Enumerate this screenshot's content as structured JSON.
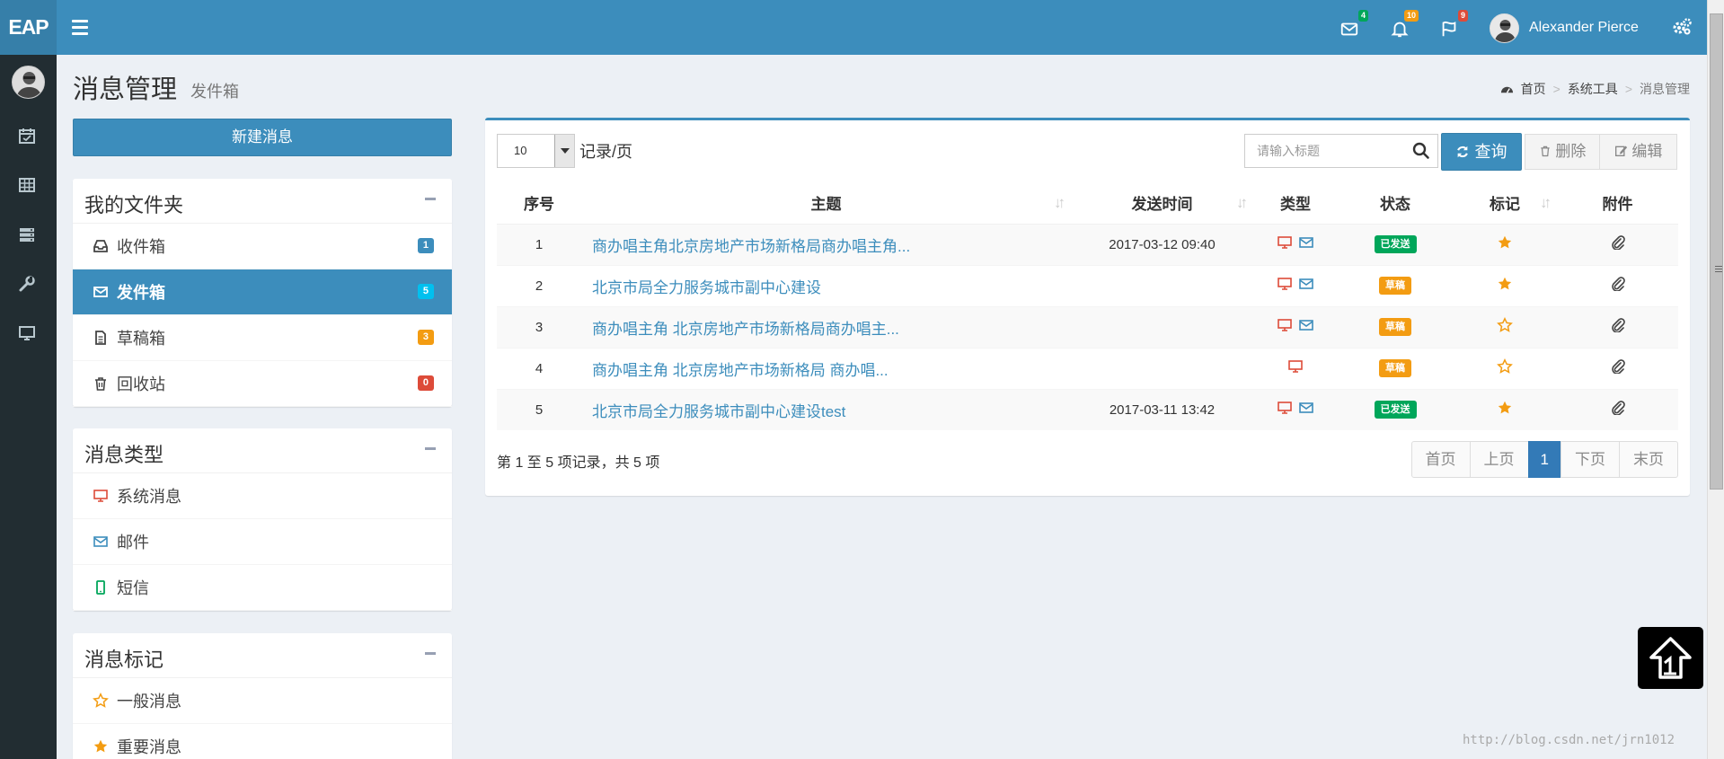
{
  "app": {
    "logo": "EAP",
    "user_name": "Alexander Pierce",
    "notifications": {
      "mail_count": "4",
      "bell_count": "10",
      "flag_count": "9"
    }
  },
  "page": {
    "title": "消息管理",
    "subtitle": "发件箱",
    "breadcrumb": [
      "首页",
      "系统工具",
      "消息管理"
    ]
  },
  "compose_label": "新建消息",
  "folders": {
    "title": "我的文件夹",
    "items": [
      {
        "label": "收件箱",
        "count": "1",
        "color": "#3c8dbc",
        "icon": "inbox-icon"
      },
      {
        "label": "发件箱",
        "count": "5",
        "color": "#00c0ef",
        "icon": "envelope-icon"
      },
      {
        "label": "草稿箱",
        "count": "3",
        "color": "#f39c12",
        "icon": "file-icon"
      },
      {
        "label": "回收站",
        "count": "0",
        "color": "#dd4b39",
        "icon": "trash-icon"
      }
    ]
  },
  "message_types": {
    "title": "消息类型",
    "items": [
      {
        "label": "系统消息",
        "icon": "monitor-icon"
      },
      {
        "label": "邮件",
        "icon": "envelope-icon"
      },
      {
        "label": "短信",
        "icon": "mobile-icon"
      }
    ]
  },
  "message_marks": {
    "title": "消息标记",
    "items": [
      {
        "label": "一般消息",
        "icon": "star-outline-icon"
      },
      {
        "label": "重要消息",
        "icon": "star-filled-icon"
      }
    ]
  },
  "toolbar": {
    "page_size": "10",
    "page_size_label": "记录/页",
    "search_placeholder": "请输入标题",
    "query_label": "查询",
    "delete_label": "删除",
    "edit_label": "编辑"
  },
  "table": {
    "headers": [
      "序号",
      "主题",
      "发送时间",
      "类型",
      "状态",
      "标记",
      "附件"
    ],
    "rows": [
      {
        "no": "1",
        "subject": "商办唱主角北京房地产市场新格局商办唱主角...",
        "time": "2017-03-12 09:40",
        "system": true,
        "mail": true,
        "status": "已发送",
        "starred": true
      },
      {
        "no": "2",
        "subject": "北京市局全力服务城市副中心建设",
        "time": "",
        "system": true,
        "mail": true,
        "status": "草稿",
        "starred": true
      },
      {
        "no": "3",
        "subject": "商办唱主角 北京房地产市场新格局商办唱主...",
        "time": "",
        "system": true,
        "mail": true,
        "status": "草稿",
        "starred": false
      },
      {
        "no": "4",
        "subject": "商办唱主角 北京房地产市场新格局 商办唱...",
        "time": "",
        "system": true,
        "mail": false,
        "status": "草稿",
        "starred": false
      },
      {
        "no": "5",
        "subject": "北京市局全力服务城市副中心建设test",
        "time": "2017-03-11 13:42",
        "system": true,
        "mail": true,
        "status": "已发送",
        "starred": true
      }
    ]
  },
  "status_colors": {
    "已发送": "#00a65a",
    "草稿": "#f39c12"
  },
  "summary": "第 1 至 5 项记录，共 5 项",
  "pager": [
    "首页",
    "上页",
    "1",
    "下页",
    "末页"
  ],
  "watermark": "http://blog.csdn.net/jrn1012",
  "colors": {
    "primary": "#3c8dbc",
    "sidebar": "#222d32",
    "star": "#f39c12",
    "system_icon": "#dd4b39"
  }
}
